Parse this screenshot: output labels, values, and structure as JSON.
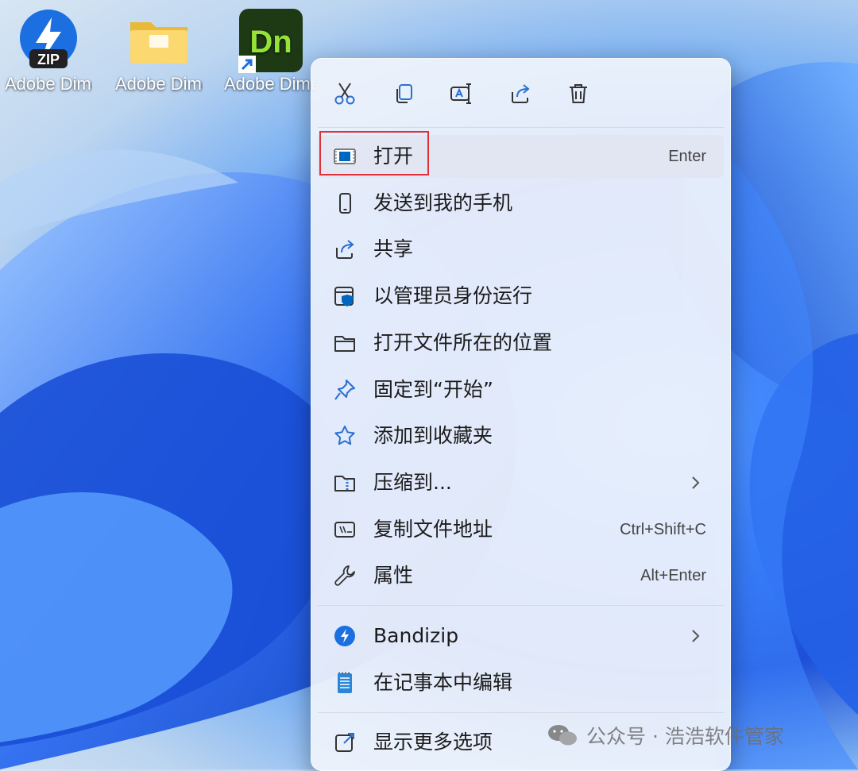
{
  "desktop": {
    "icons": [
      {
        "name": "zip",
        "label": "Adobe Dimensi...",
        "badge": "ZIP"
      },
      {
        "name": "folder",
        "label": "Adobe Dimensi..."
      },
      {
        "name": "dn-shortcut",
        "label": "Adobe Dimension",
        "badge": "Dn"
      }
    ]
  },
  "context_menu": {
    "toolbar": [
      "cut-icon",
      "copy-icon",
      "rename-icon",
      "share-icon",
      "delete-icon"
    ],
    "items": [
      {
        "label": "打开",
        "shortcut": "Enter",
        "icon": "open-app-icon"
      },
      {
        "label": "发送到我的手机",
        "icon": "phone-icon"
      },
      {
        "label": "共享",
        "icon": "share-icon"
      },
      {
        "label": "以管理员身份运行",
        "icon": "admin-shield-icon"
      },
      {
        "label": "打开文件所在的位置",
        "icon": "folder-icon"
      },
      {
        "label": "固定到“开始”",
        "icon": "pin-icon"
      },
      {
        "label": "添加到收藏夹",
        "icon": "star-icon"
      },
      {
        "label": "压缩到...",
        "icon": "zip-folder-icon",
        "submenu": true
      },
      {
        "label": "复制文件地址",
        "shortcut": "Ctrl+Shift+C",
        "icon": "copy-path-icon"
      },
      {
        "label": "属性",
        "shortcut": "Alt+Enter",
        "icon": "wrench-icon"
      },
      {
        "label": "Bandizip",
        "icon": "bandizip-icon",
        "submenu": true
      },
      {
        "label": "在记事本中编辑",
        "icon": "notepad-icon"
      },
      {
        "label": "显示更多选项",
        "icon": "more-options-icon"
      }
    ]
  },
  "watermark": {
    "text": "公众号 · 浩浩软件管家"
  },
  "colors": {
    "accent": "#0067c0",
    "highlight_box": "#e0303a"
  }
}
